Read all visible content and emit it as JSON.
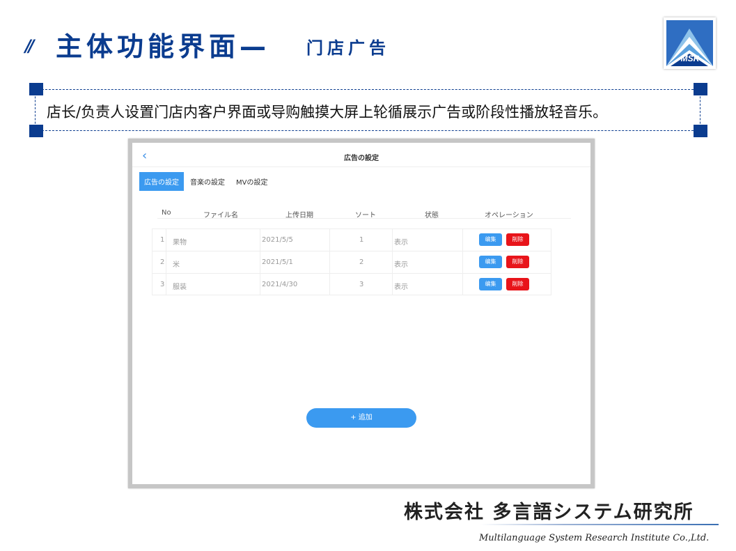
{
  "slide": {
    "slashes": "//",
    "title_main": "主体功能界面—",
    "title_sub": "门店广告",
    "logo_text": "MSR",
    "description": "店长/负责人设置门店内客户界面或导购触摸大屏上轮循展示广告或阶段性播放轻音乐。"
  },
  "app": {
    "back_icon": "‹",
    "title": "広告の設定",
    "tabs": [
      {
        "label": "広告の設定",
        "active": true
      },
      {
        "label": "音楽の設定",
        "active": false
      },
      {
        "label": "MVの設定",
        "active": false
      }
    ],
    "columns": {
      "no": "No",
      "file": "ファイル名",
      "date": "上传日期",
      "sort": "ソート",
      "status": "状態",
      "ops": "オペレーション"
    },
    "rows": [
      {
        "no": "1",
        "file": "果物",
        "date": "2021/5/5",
        "sort": "1",
        "status": "表示",
        "edit": "编集",
        "delete": "削除"
      },
      {
        "no": "2",
        "file": "米",
        "date": "2021/5/1",
        "sort": "2",
        "status": "表示",
        "edit": "编集",
        "delete": "削除"
      },
      {
        "no": "3",
        "file": "服装",
        "date": "2021/4/30",
        "sort": "3",
        "status": "表示",
        "edit": "编集",
        "delete": "削除"
      }
    ],
    "add_button": "+ 追加"
  },
  "footer": {
    "company_jp": "株式会社 多言語システム研究所",
    "company_en": "Multilanguage System Research Institute Co.,Ltd."
  },
  "colors": {
    "brand_blue": "#0b3c8f",
    "accent_blue": "#3b9af0",
    "danger_red": "#e8141a"
  }
}
